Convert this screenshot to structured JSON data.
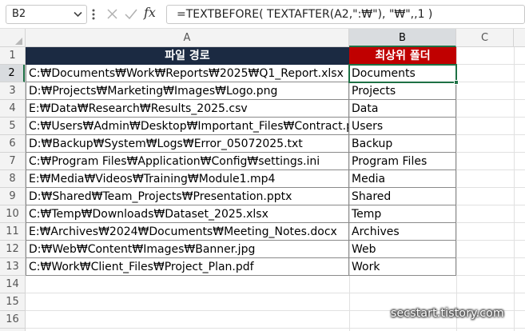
{
  "formula_bar": {
    "name_box": "B2",
    "cancel_icon": "x-icon",
    "enter_icon": "check-icon",
    "fx_label": "fx",
    "formula": "=TEXTBEFORE( TEXTAFTER(A2,\":₩\"), \"₩\",,1 )"
  },
  "columns": [
    "A",
    "B",
    "C"
  ],
  "rows": [
    "1",
    "2",
    "3",
    "4",
    "5",
    "6",
    "7",
    "8",
    "9",
    "10",
    "11",
    "12",
    "13",
    "14",
    "15",
    "16"
  ],
  "table": {
    "header_a": "파일 경로",
    "header_b": "최상위 폴더",
    "rows": [
      {
        "path": "C:₩Documents₩Work₩Reports₩2025₩Q1_Report.xlsx",
        "folder": "Documents"
      },
      {
        "path": "D:₩Projects₩Marketing₩Images₩Logo.png",
        "folder": "Projects"
      },
      {
        "path": "E:₩Data₩Research₩Results_2025.csv",
        "folder": "Data"
      },
      {
        "path": "C:₩Users₩Admin₩Desktop₩Important_Files₩Contract.pdf",
        "folder": "Users"
      },
      {
        "path": "D:₩Backup₩System₩Logs₩Error_05072025.txt",
        "folder": "Backup"
      },
      {
        "path": "C:₩Program Files₩Application₩Config₩settings.ini",
        "folder": "Program Files"
      },
      {
        "path": "E:₩Media₩Videos₩Training₩Module1.mp4",
        "folder": "Media"
      },
      {
        "path": "D:₩Shared₩Team_Projects₩Presentation.pptx",
        "folder": "Shared"
      },
      {
        "path": "C:₩Temp₩Downloads₩Dataset_2025.xlsx",
        "folder": "Temp"
      },
      {
        "path": "E:₩Archives₩2024₩Documents₩Meeting_Notes.docx",
        "folder": "Archives"
      },
      {
        "path": "D:₩Web₩Content₩Images₩Banner.jpg",
        "folder": "Web"
      },
      {
        "path": "C:₩Work₩Client_Files₩Project_Plan.pdf",
        "folder": "Work"
      }
    ]
  },
  "colors": {
    "header_a_bg": "#1b2a42",
    "header_b_bg": "#c00000",
    "selection": "#1e7145"
  },
  "watermark": "secstart.tistory.com"
}
